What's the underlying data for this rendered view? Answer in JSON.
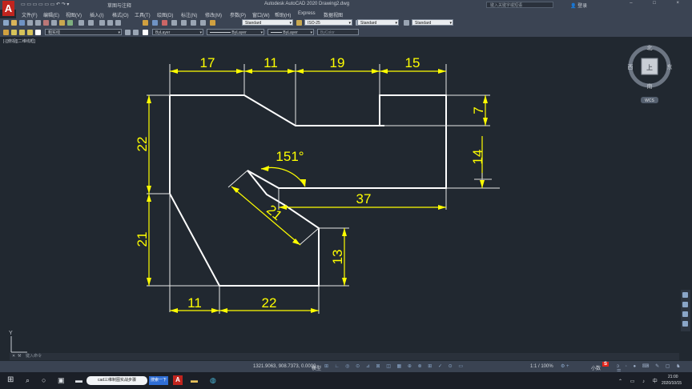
{
  "window": {
    "title": "Autodesk AutoCAD 2020    Drawing2.dwg",
    "search_placeholder": "键入关键字或短语",
    "login": "登录",
    "app_letter": "A",
    "controls": "– □ ×"
  },
  "quick_access": {
    "workspace": "草图与注释"
  },
  "menu": [
    "文件(F)",
    "编辑(E)",
    "视图(V)",
    "插入(I)",
    "格式(O)",
    "工具(T)",
    "绘图(D)",
    "标注(N)",
    "修改(M)",
    "参数(P)",
    "窗口(W)",
    "帮助(H)",
    "Express",
    "数据视图"
  ],
  "styles": {
    "text_style": "Standard",
    "dim_style": "ISO-25",
    "table_style": "Standard",
    "multileader_style": "Standard"
  },
  "layers": {
    "current_layer": "粗实线",
    "color": "ByLayer",
    "linetype": "ByLayer",
    "lineweight": "ByLayer",
    "plot_style": "ByColor"
  },
  "viewport_label": "[-][俯视][二维线框]",
  "viewcube": {
    "north": "北",
    "south": "南",
    "east": "东",
    "west": "西",
    "top": "上",
    "wcs": "WCS"
  },
  "ucs": {
    "x": "X",
    "y": "Y"
  },
  "dimensions": {
    "d17": "17",
    "d11_top": "11",
    "d19": "19",
    "d15": "15",
    "d7": "7",
    "d14": "14",
    "d22_left": "22",
    "d21_left": "21",
    "d37": "37",
    "d21_slant": "21",
    "angle": "151°",
    "d13": "13",
    "d11_bottom": "11",
    "d22_bottom": "22"
  },
  "command": {
    "placeholder": "键入命令"
  },
  "statusbar": {
    "coords": "1321.9063, 908.7373, 0.0000",
    "model": "模型",
    "scale": "1:1 / 100%",
    "decimal": "小数"
  },
  "taskbar": {
    "task1": "cad三维制图实战步骤",
    "task2": "搜索一下",
    "clock_time": "21:00",
    "clock_date": "2020/10/15"
  },
  "colors": {
    "background": "#212830",
    "dimension": "#ffff00",
    "geometry": "#ffffff"
  }
}
